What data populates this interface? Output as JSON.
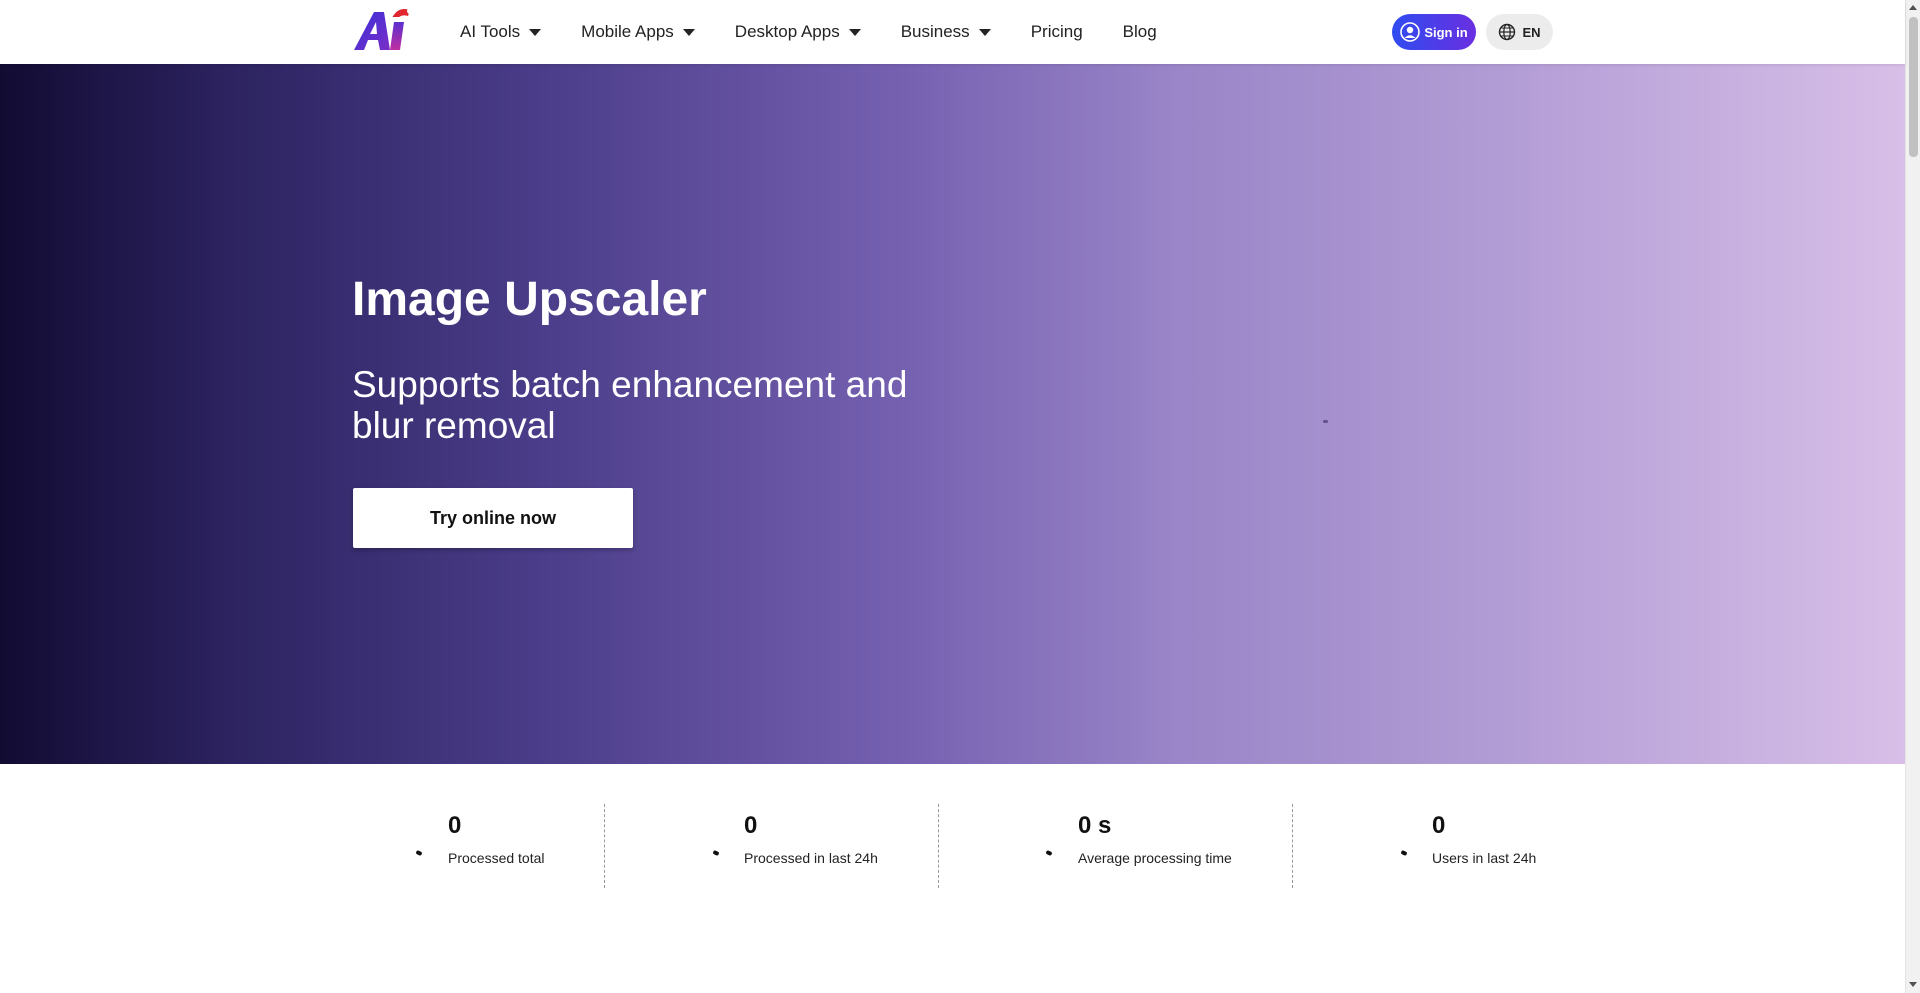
{
  "header": {
    "logo_icon": "ai-logo-icon",
    "nav": [
      {
        "label": "AI Tools",
        "has_dropdown": true
      },
      {
        "label": "Mobile Apps",
        "has_dropdown": true
      },
      {
        "label": "Desktop Apps",
        "has_dropdown": true
      },
      {
        "label": "Business",
        "has_dropdown": true
      },
      {
        "label": "Pricing",
        "has_dropdown": false
      },
      {
        "label": "Blog",
        "has_dropdown": false
      }
    ],
    "sign_in_label": "Sign in",
    "language_label": "EN"
  },
  "hero": {
    "title": "Image Upscaler",
    "subtitle": "Supports batch enhancement and blur removal",
    "cta_label": "Try online now",
    "gradient_colors": [
      "#120b32",
      "#4a3c88",
      "#9a86c8",
      "#d8bfe8"
    ]
  },
  "stats": [
    {
      "value": "0",
      "label": "Processed total"
    },
    {
      "value": "0",
      "label": "Processed in last 24h"
    },
    {
      "value": "0 s",
      "label": "Average processing time"
    },
    {
      "value": "0",
      "label": "Users in last 24h"
    }
  ],
  "colors": {
    "sign_in_gradient_start": "#2f4cf0",
    "sign_in_gradient_end": "#6a2fe0",
    "language_button_bg": "#ececec"
  }
}
